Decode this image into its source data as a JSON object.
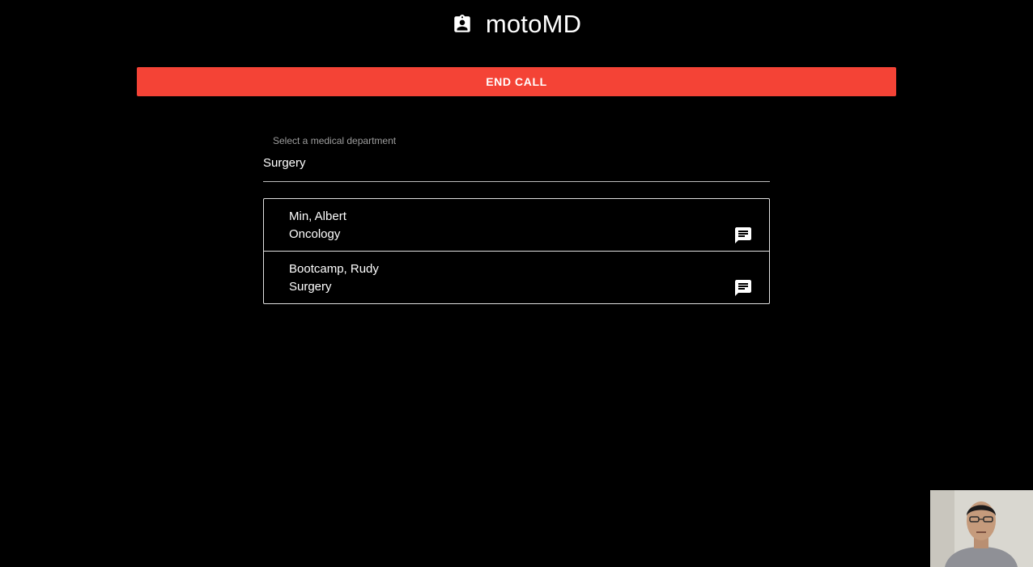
{
  "header": {
    "title": "motoMD",
    "logo_icon": "badge-icon"
  },
  "call": {
    "end_label": "END CALL",
    "button_color": "#f44336"
  },
  "department_select": {
    "label": "Select a medical department",
    "value": "Surgery"
  },
  "doctors": [
    {
      "name": "Min, Albert",
      "department": "Oncology",
      "action_icon": "chat-icon"
    },
    {
      "name": "Bootcamp, Rudy",
      "department": "Surgery",
      "action_icon": "chat-icon"
    }
  ],
  "video_preview": {
    "icon": "self-video-icon"
  }
}
